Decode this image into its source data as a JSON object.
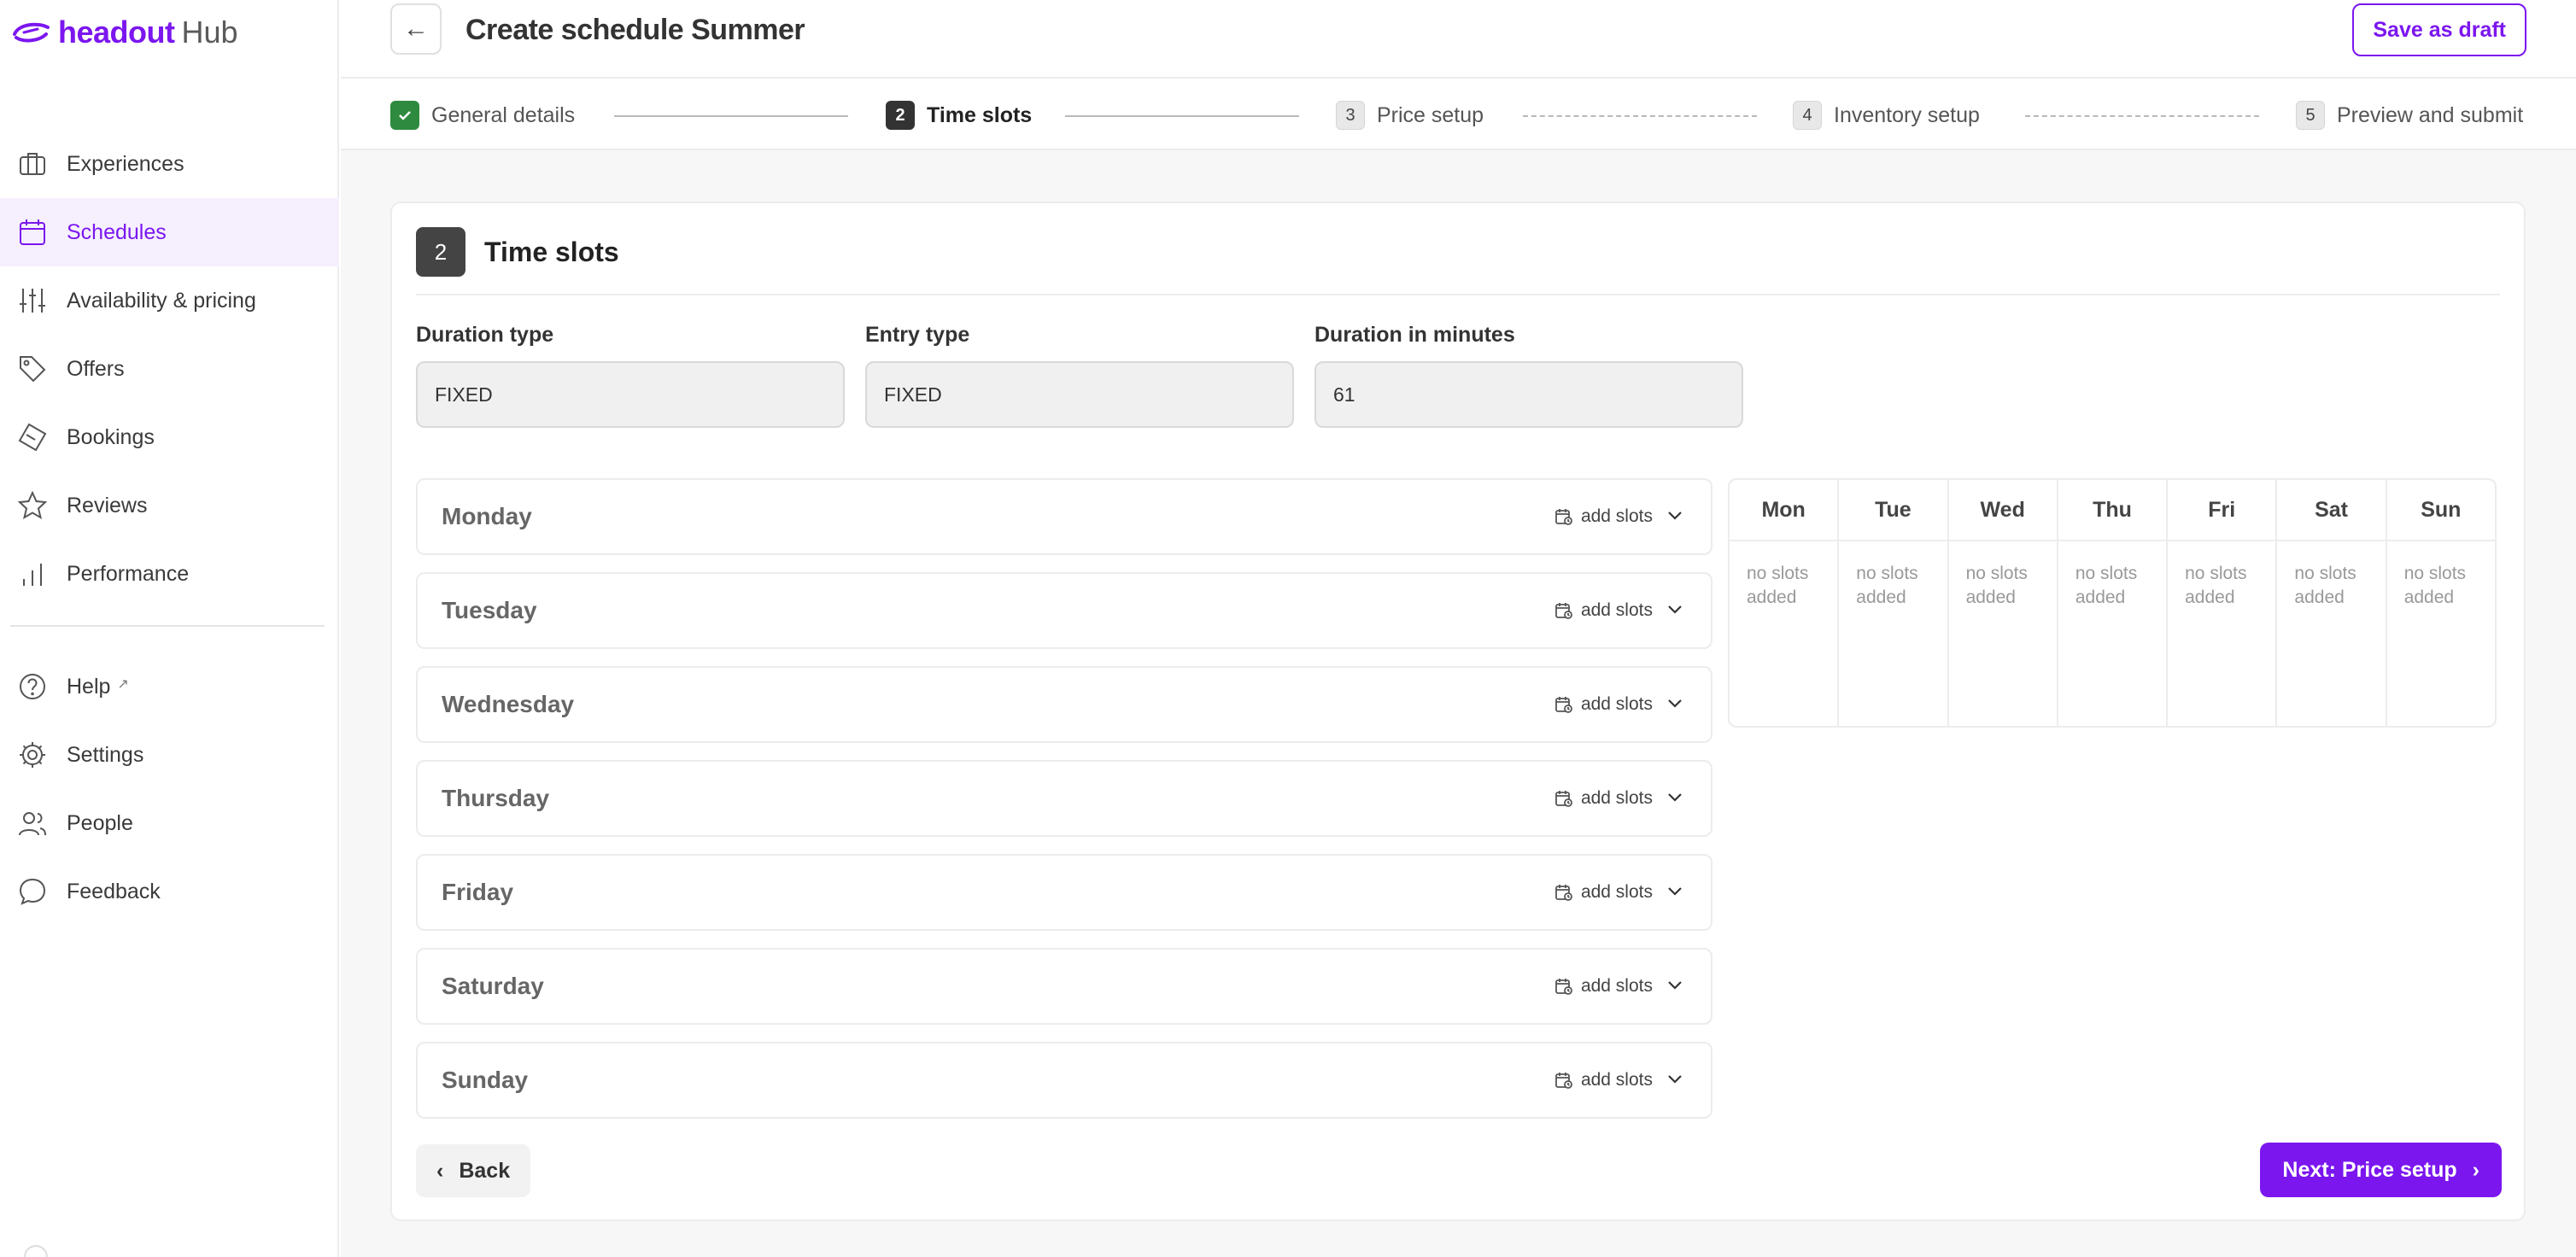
{
  "brand": {
    "name": "headout",
    "suffix": "Hub",
    "accent": "#7b16ef"
  },
  "sidebar": {
    "items": [
      {
        "label": "Experiences",
        "icon": "suitcase-icon"
      },
      {
        "label": "Schedules",
        "icon": "calendar-icon",
        "active": true
      },
      {
        "label": "Availability & pricing",
        "icon": "sliders-icon"
      },
      {
        "label": "Offers",
        "icon": "tag-icon"
      },
      {
        "label": "Bookings",
        "icon": "ticket-icon"
      },
      {
        "label": "Reviews",
        "icon": "star-icon"
      },
      {
        "label": "Performance",
        "icon": "bar-chart-icon"
      }
    ],
    "secondary": [
      {
        "label": "Help",
        "icon": "help-circle-icon"
      },
      {
        "label": "Settings",
        "icon": "gear-icon"
      },
      {
        "label": "People",
        "icon": "people-icon"
      },
      {
        "label": "Feedback",
        "icon": "chat-bubble-icon"
      }
    ]
  },
  "header": {
    "title": "Create schedule Summer",
    "save_draft": "Save as draft"
  },
  "stepper": {
    "steps": [
      {
        "num": "1",
        "label": "General details",
        "state": "done"
      },
      {
        "num": "2",
        "label": "Time slots",
        "state": "current"
      },
      {
        "num": "3",
        "label": "Price setup",
        "state": "upcoming"
      },
      {
        "num": "4",
        "label": "Inventory setup",
        "state": "upcoming"
      },
      {
        "num": "5",
        "label": "Preview and submit",
        "state": "upcoming"
      }
    ]
  },
  "card": {
    "step_num": "2",
    "title": "Time slots",
    "fields": {
      "duration_type": {
        "label": "Duration type",
        "value": "FIXED"
      },
      "entry_type": {
        "label": "Entry type",
        "value": "FIXED"
      },
      "duration_minutes": {
        "label": "Duration in minutes",
        "value": "61"
      }
    },
    "add_slots_label": "add slots",
    "days": [
      "Monday",
      "Tuesday",
      "Wednesday",
      "Thursday",
      "Friday",
      "Saturday",
      "Sunday"
    ],
    "week_headers": [
      "Mon",
      "Tue",
      "Wed",
      "Thu",
      "Fri",
      "Sat",
      "Sun"
    ],
    "empty_slot_text": "no slots added",
    "back_label": "Back",
    "next_label": "Next: Price setup"
  }
}
